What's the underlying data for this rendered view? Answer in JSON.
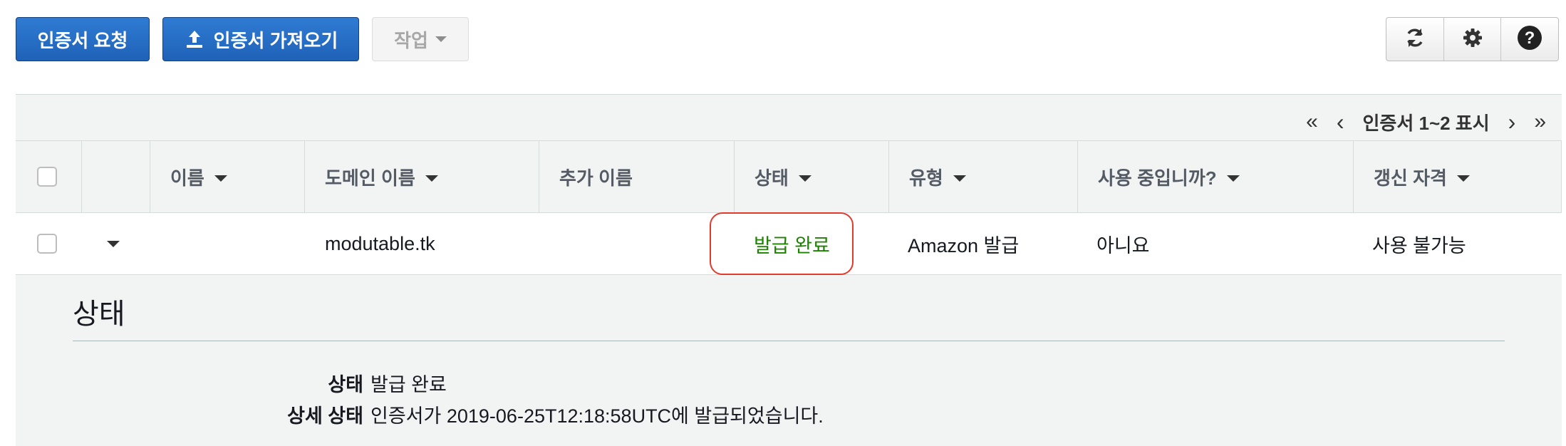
{
  "toolbar": {
    "request_label": "인증서 요청",
    "import_label": "인증서 가져오기",
    "actions_label": "작업",
    "icons": [
      "refresh-icon",
      "gear-icon",
      "help-icon"
    ]
  },
  "pager": {
    "first": "«",
    "prev": "‹",
    "text": "인증서 1~2 표시",
    "next": "›",
    "last": "»"
  },
  "table": {
    "columns": [
      "이름",
      "도메인 이름",
      "추가 이름",
      "상태",
      "유형",
      "사용 중입니까?",
      "갱신 자격"
    ],
    "rows": [
      {
        "name": "",
        "domain": "modutable.tk",
        "additional": "",
        "status": "발급 완료",
        "type": "Amazon 발급",
        "in_use": "아니요",
        "renewal": "사용 불가능"
      }
    ]
  },
  "detail": {
    "title": "상태",
    "fields": [
      {
        "label": "상태",
        "value": "발급 완료"
      },
      {
        "label": "상세 상태",
        "value": "인증서가 2019-06-25T12:18:58UTC에 발급되었습니다."
      }
    ]
  },
  "colors": {
    "primary": "#1f62b8",
    "status_ok": "#1d8102",
    "highlight": "#e23b2e"
  }
}
